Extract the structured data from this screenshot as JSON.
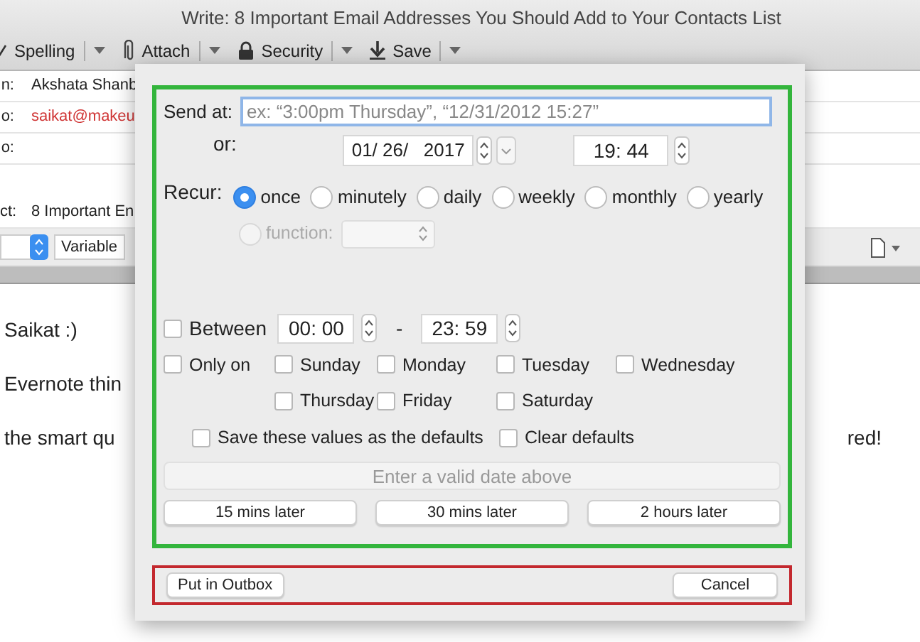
{
  "window": {
    "title": "Write: 8 Important Email Addresses You Should Add to Your Contacts List"
  },
  "toolbar": [
    {
      "label": "Spelling",
      "kind": "check"
    },
    {
      "label": "Attach",
      "kind": "clip"
    },
    {
      "label": "Security",
      "kind": "lock"
    },
    {
      "label": "Save",
      "kind": "down"
    }
  ],
  "compose": {
    "fields": [
      {
        "label": "n:",
        "value": "Akshata Shanb",
        "kind": "text"
      },
      {
        "label": "o:",
        "value": "saikat@makeu",
        "kind": "address"
      },
      {
        "label": "o:"
      },
      {
        "label": "ct:",
        "value": "8 Important En",
        "kind": "text"
      }
    ],
    "format": "Variable",
    "body": [
      "Saikat :)",
      "Evernote thin",
      "the smart qu"
    ],
    "body_right": "red!"
  },
  "dialog": {
    "send_at_label": "Send at:",
    "send_at_placeholder": "ex: “3:00pm Thursday”, “12/31/2012 15:27”",
    "or_label": "or:",
    "date": "01/ 26/   2017",
    "time": "19: 44",
    "recur_label": "Recur:",
    "recur": [
      {
        "label": "once",
        "selected": true
      },
      {
        "label": "minutely",
        "selected": false
      },
      {
        "label": "daily",
        "selected": false
      },
      {
        "label": "weekly",
        "selected": false
      },
      {
        "label": "monthly",
        "selected": false
      },
      {
        "label": "yearly",
        "selected": false
      }
    ],
    "function": {
      "label": "function:",
      "selected": false,
      "disabled": true
    },
    "between": {
      "label": "Between",
      "checked": false,
      "from": "00: 00",
      "dash": "-",
      "to": "23: 59"
    },
    "only_on": {
      "label": "Only on",
      "checked": false
    },
    "days": [
      {
        "label": "Sunday",
        "checked": false
      },
      {
        "label": "Monday",
        "checked": false
      },
      {
        "label": "Tuesday",
        "checked": false
      },
      {
        "label": "Wednesday",
        "checked": false
      },
      {
        "label": "Thursday",
        "checked": false
      },
      {
        "label": "Friday",
        "checked": false
      },
      {
        "label": "Saturday",
        "checked": false
      }
    ],
    "save_defaults": {
      "label": "Save these values as the defaults",
      "checked": false
    },
    "clear_defaults": {
      "label": "Clear defaults",
      "checked": false
    },
    "status_button": {
      "label": "Enter a valid date above",
      "disabled": true
    },
    "quick_buttons": [
      "15 mins later",
      "30 mins later",
      "2 hours later"
    ],
    "footer": {
      "left": "Put in Outbox",
      "right": "Cancel"
    }
  }
}
